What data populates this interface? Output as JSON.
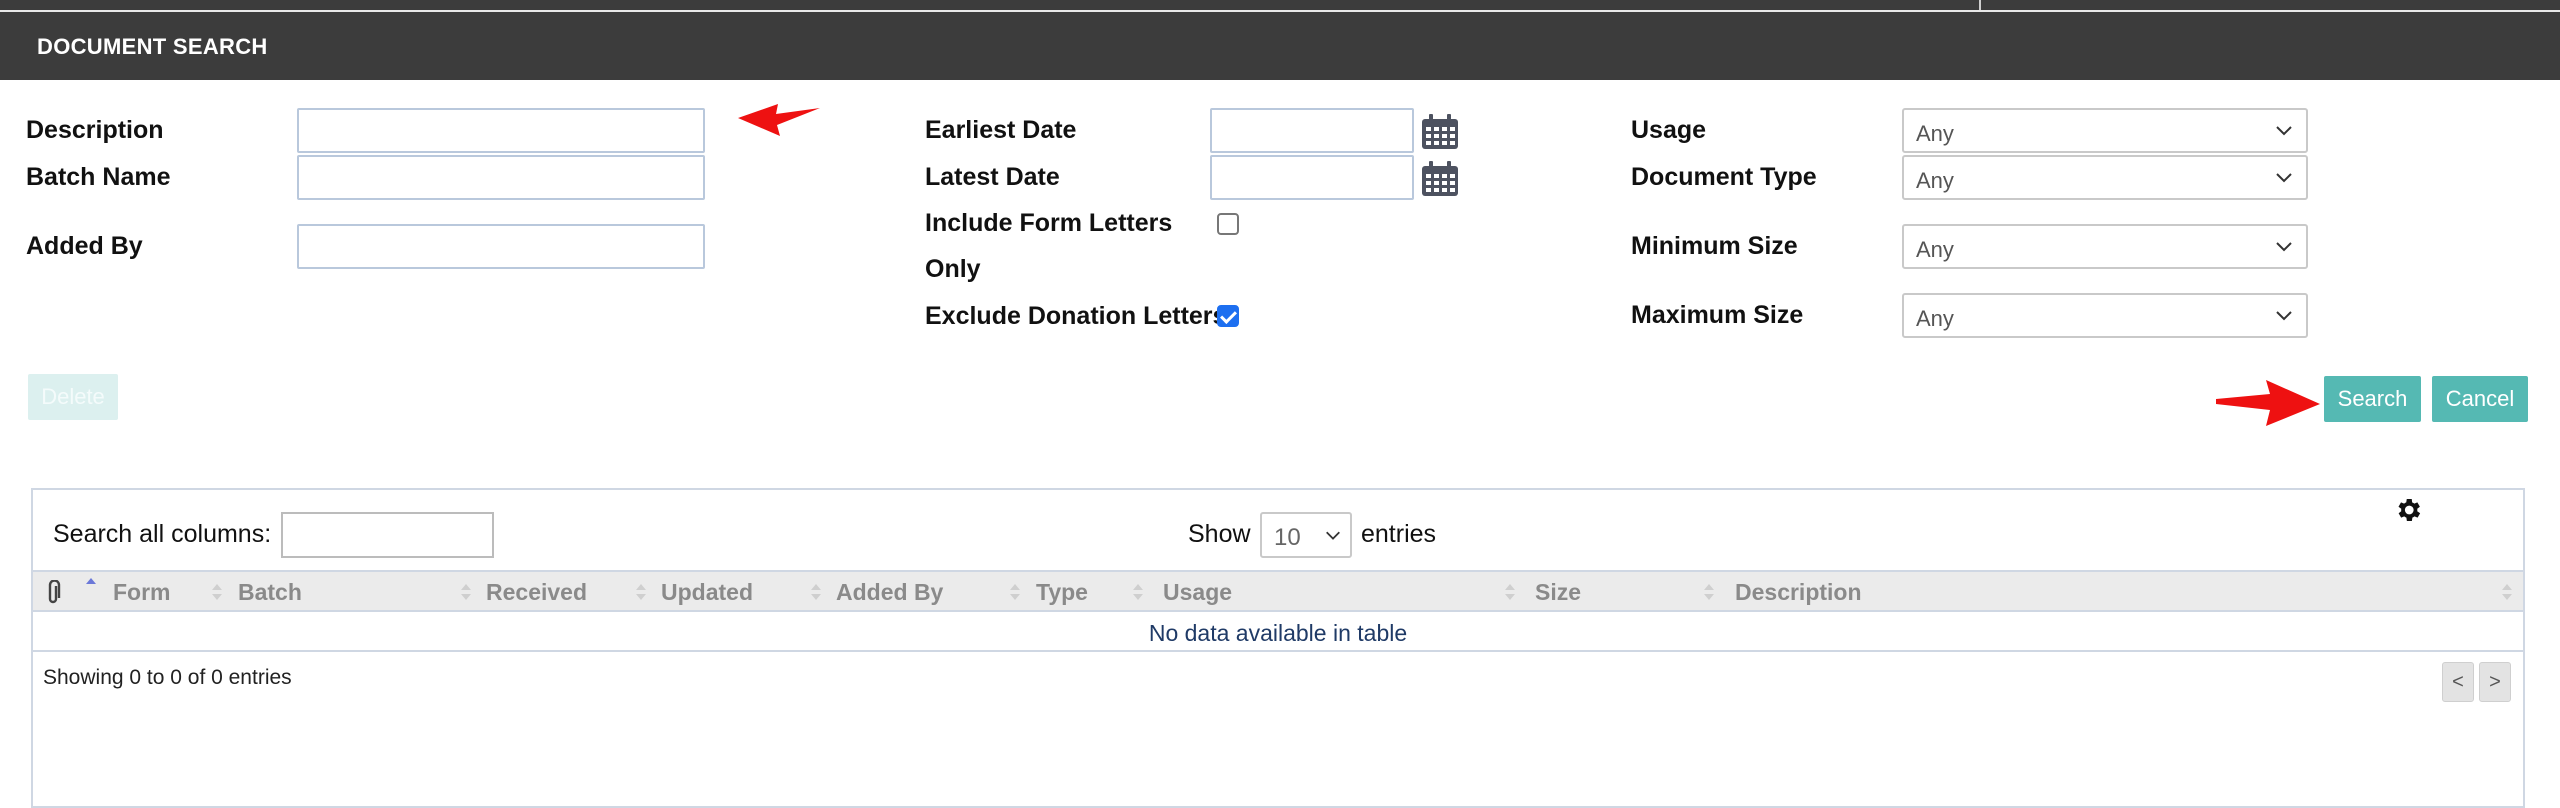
{
  "header": {
    "title": "DOCUMENT SEARCH"
  },
  "form": {
    "description_label": "Description",
    "batch_name_label": "Batch Name",
    "added_by_label": "Added By",
    "earliest_date_label": "Earliest Date",
    "latest_date_label": "Latest Date",
    "include_form_letters_label_1": "Include Form Letters",
    "include_form_letters_label_2": "Only",
    "include_form_letters_checked": false,
    "exclude_donation_letters_label": "Exclude Donation Letters",
    "exclude_donation_letters_checked": true,
    "usage_label": "Usage",
    "usage_value": "Any",
    "document_type_label": "Document Type",
    "document_type_value": "Any",
    "minimum_size_label": "Minimum Size",
    "minimum_size_value": "Any",
    "maximum_size_label": "Maximum Size",
    "maximum_size_value": "Any"
  },
  "buttons": {
    "delete_label": "Delete",
    "search_label": "Search",
    "cancel_label": "Cancel"
  },
  "table": {
    "search_all_label": "Search all columns:",
    "show_label": "Show",
    "show_value": "10",
    "entries_label": "entries",
    "columns": [
      "Form",
      "Batch",
      "Received",
      "Updated",
      "Added By",
      "Type",
      "Usage",
      "Size",
      "Description"
    ],
    "empty_message": "No data available in table",
    "info": "Showing 0 to 0 of 0 entries",
    "prev_label": "<",
    "next_label": ">"
  },
  "colors": {
    "header_bg": "#3c3c3c",
    "teal_button": "#55b9b3",
    "arrow_red": "#ee1111",
    "checkbox_blue": "#1d6ff0"
  }
}
